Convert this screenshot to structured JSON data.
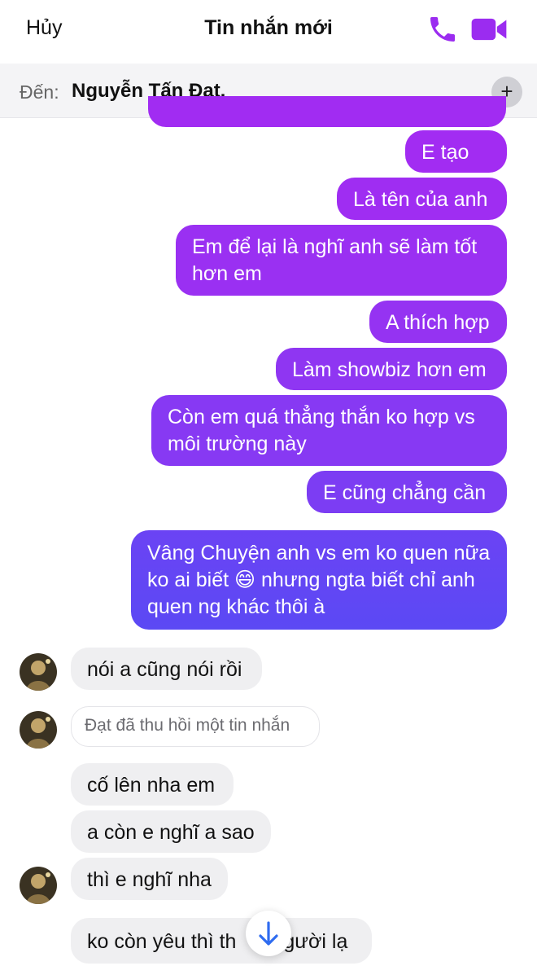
{
  "header": {
    "cancel_label": "Hủy",
    "title": "Tin nhắn mới",
    "call_icon": "phone-icon",
    "video_icon": "video-camera-icon",
    "accent_color": "#9b2cf0"
  },
  "to_bar": {
    "label": "Đến:",
    "recipient": "Nguyễn Tấn Đạt,",
    "add_icon": "plus-icon"
  },
  "messages": {
    "out": [
      {
        "text": "E tạo ra"
      },
      {
        "text": "Là tên của anh"
      },
      {
        "text": "Em để lại là nghĩ anh sẽ làm tốt hơn em"
      },
      {
        "text": "A thích hợp"
      },
      {
        "text": "Làm showbiz hơn em"
      },
      {
        "text": "Còn em quá thẳng thắn ko hợp vs môi trường này"
      },
      {
        "text": "E cũng chẳng cần"
      },
      {
        "text": "Vâng Chuyện anh vs em ko quen nữa ko ai biết 😄 nhưng ngta biết chỉ anh quen ng khác thôi à"
      }
    ],
    "in": [
      {
        "text": "nói a cũng nói rồi"
      },
      {
        "text": "Đạt đã thu hồi một tin nhắn"
      },
      {
        "text": "cố lên nha em"
      },
      {
        "text": "a còn e nghĩ a sao"
      },
      {
        "text": "thì e nghĩ nha"
      },
      {
        "text": "ko còn yêu thì th",
        "tail": "người lạ"
      }
    ]
  },
  "colors": {
    "gradient_top": "#a32cf2",
    "gradient_bottom": "#5b49f4",
    "incoming_bg": "#efeff1"
  },
  "scroll_button_icon": "arrow-down-icon"
}
